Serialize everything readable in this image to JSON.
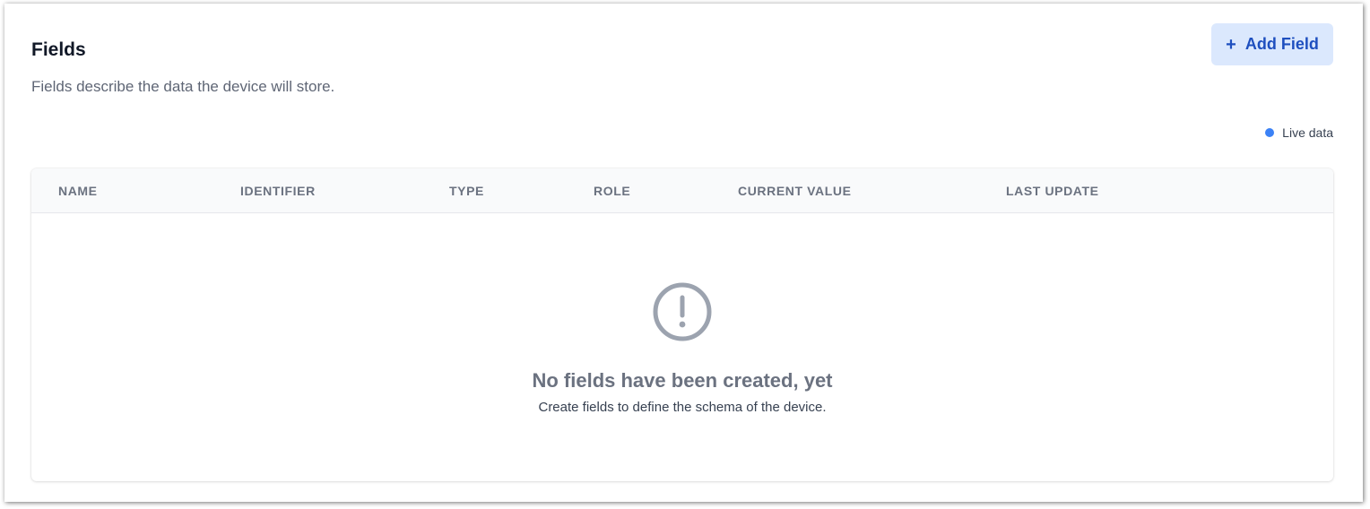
{
  "header": {
    "title": "Fields",
    "subtitle": "Fields describe the data the device will store.",
    "add_button": {
      "icon": "plus-icon",
      "label": "Add Field"
    }
  },
  "live_indicator": {
    "label": "Live data",
    "color": "#3b82f6"
  },
  "table": {
    "columns": [
      "Name",
      "Identifier",
      "Type",
      "Role",
      "Current Value",
      "Last Update"
    ],
    "rows": []
  },
  "empty_state": {
    "icon": "exclamation-circle-icon",
    "title": "No fields have been created, yet",
    "description": "Create fields to define the schema of the device."
  },
  "colors": {
    "accent": "#1e4fbf",
    "accent_bg": "#dbe8fd",
    "muted": "#6b7280"
  }
}
